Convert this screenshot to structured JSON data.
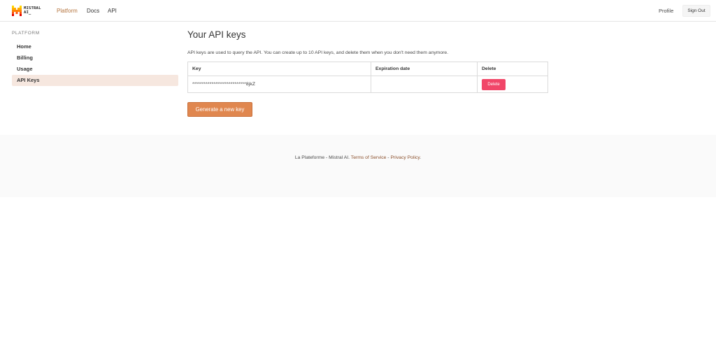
{
  "brand": {
    "line1": "MISTRAL",
    "line2": "AI_",
    "colors": [
      "#ffd700",
      "#ffaf00",
      "#ff8205",
      "#fa500f",
      "#e10500",
      "#000000"
    ]
  },
  "navbar": {
    "platform_label": "Platform",
    "docs_label": "Docs",
    "api_label": "API",
    "profile_label": "Profile",
    "signout_label": "Sign Out",
    "accent_color": "#b5753f"
  },
  "sidebar": {
    "section_label": "PLATFORM",
    "items": [
      {
        "label": "Home",
        "active": false
      },
      {
        "label": "Billing",
        "active": false
      },
      {
        "label": "Usage",
        "active": false
      },
      {
        "label": "API Keys",
        "active": true
      }
    ]
  },
  "main": {
    "title": "Your API keys",
    "intro": "API keys are used to query the API. You can create up to 10 API keys, and delete them when you don't need them anymore.",
    "table": {
      "headers": [
        "Key",
        "Expiration date",
        "Delete"
      ],
      "rows": [
        {
          "key": "****************************8jkZ",
          "expiration": "",
          "delete_label": "Delete"
        }
      ]
    },
    "generate_label": "Generate a new key",
    "delete_color": "#f14668",
    "generate_color": "#e0874f"
  },
  "footer": {
    "prefix": "La Plateforme - Mistral AI. ",
    "terms_label": "Terms of Service",
    "separator": " - ",
    "privacy_label": "Privacy Policy",
    "suffix": "."
  }
}
